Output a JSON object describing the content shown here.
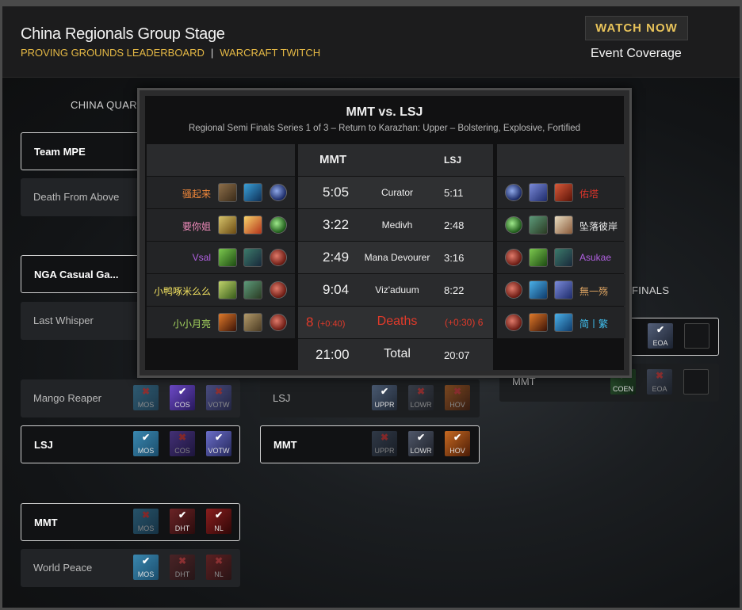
{
  "header": {
    "title": "China Regionals Group Stage",
    "link_leaderboard": "PROVING GROUNDS LEADERBOARD",
    "link_sep": "|",
    "link_twitch": "WARCRAFT TWITCH",
    "watch_button": "WATCH NOW",
    "event_coverage": "Event Coverage"
  },
  "bracket": {
    "col_quarter": "CHINA QUART",
    "col_finals": "FINALS",
    "teams": [
      {
        "name": "Team MPE"
      },
      {
        "name": "Death From Above"
      },
      {
        "name": "NGA Casual Ga..."
      },
      {
        "name": "Last Whisper"
      },
      {
        "name": "Mango Reaper",
        "dungeons": [
          {
            "code": "MOS",
            "result": "loss"
          },
          {
            "code": "COS",
            "result": "win"
          },
          {
            "code": "VOTW",
            "result": "loss"
          }
        ]
      },
      {
        "name": "LSJ",
        "dungeons": [
          {
            "code": "MOS",
            "result": "win"
          },
          {
            "code": "COS",
            "result": "loss"
          },
          {
            "code": "VOTW",
            "result": "win"
          }
        ]
      },
      {
        "name": "MMT",
        "dungeons": [
          {
            "code": "MOS",
            "result": "loss"
          },
          {
            "code": "DHT",
            "result": "win"
          },
          {
            "code": "NL",
            "result": "win"
          }
        ]
      },
      {
        "name": "World Peace",
        "dungeons": [
          {
            "code": "MOS",
            "result": "win"
          },
          {
            "code": "DHT",
            "result": "loss"
          },
          {
            "code": "NL",
            "result": "loss"
          }
        ]
      }
    ],
    "semis": [
      {
        "name": "LSJ",
        "dungeons": [
          {
            "code": "UPPR",
            "result": "win"
          },
          {
            "code": "LOWR",
            "result": "loss"
          },
          {
            "code": "HOV",
            "result": "loss"
          }
        ]
      },
      {
        "name": "MMT",
        "dungeons": [
          {
            "code": "UPPR",
            "result": "loss"
          },
          {
            "code": "LOWR",
            "result": "win"
          },
          {
            "code": "HOV",
            "result": "win"
          }
        ]
      }
    ],
    "finals": [
      {
        "name": "",
        "dungeons": [
          {
            "code": "EOA",
            "result": "win"
          }
        ]
      },
      {
        "name": "MMT",
        "dungeons": [
          {
            "code": "COEN",
            "result": "win"
          },
          {
            "code": "EOA",
            "result": "loss"
          }
        ]
      }
    ]
  },
  "popup": {
    "title": "MMT  vs. LSJ",
    "subtitle": "Regional Semi Finals Series 1 of 3 – Return to Karazhan: Upper – Bolstering, Explosive, Fortified",
    "team_left": "MMT",
    "team_right": "LSJ",
    "left_players": [
      {
        "name": "骚起来",
        "color": "#f0873a"
      },
      {
        "name": "要你姐",
        "color": "#f08bbb"
      },
      {
        "name": "Vsal",
        "color": "#b060e0"
      },
      {
        "name": "小鸭啄米么么",
        "color": "#f0e060"
      },
      {
        "name": "小小月亮",
        "color": "#a8d860"
      }
    ],
    "right_players": [
      {
        "name": "佑塔",
        "color": "#d8342a"
      },
      {
        "name": "坠落彼岸",
        "color": "#f0f0f0"
      },
      {
        "name": "Asukae",
        "color": "#b060e0"
      },
      {
        "name": "無一殇",
        "color": "#d8a060"
      },
      {
        "name": "简丨繁",
        "color": "#40c0f0"
      }
    ],
    "rows": [
      {
        "label": "Curator",
        "left": "5:05",
        "right": "5:11"
      },
      {
        "label": "Medivh",
        "left": "3:22",
        "right": "2:48"
      },
      {
        "label": "Mana Devourer",
        "left": "2:49",
        "right": "3:16"
      },
      {
        "label": "Viz'aduum",
        "left": "9:04",
        "right": "8:22"
      }
    ],
    "deaths": {
      "label": "Deaths",
      "left_count": "8",
      "left_penalty": "(+0:40)",
      "right_penalty": "(+0:30)",
      "right_count": "6"
    },
    "total": {
      "label": "Total",
      "left": "21:00",
      "right": "20:07"
    }
  },
  "colors": {
    "accent": "#e4b845",
    "deaths": "#e23a2a"
  }
}
